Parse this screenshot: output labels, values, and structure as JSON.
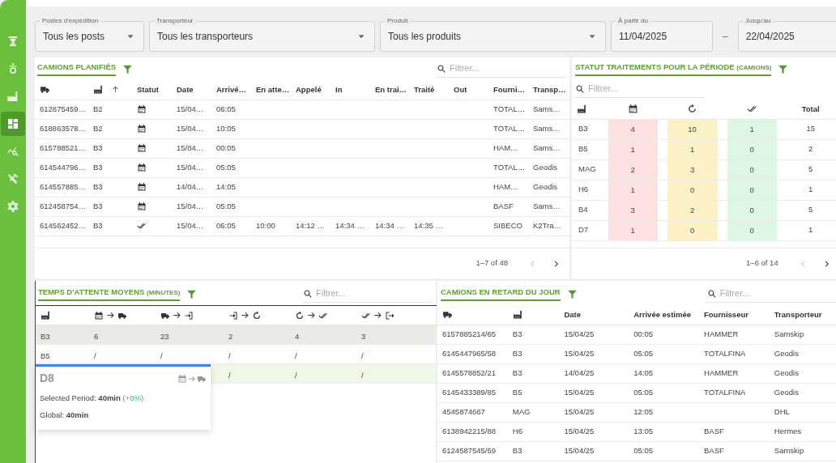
{
  "sidebar": {
    "items": [
      {
        "kind": "hopper",
        "selected": false
      },
      {
        "kind": "weight",
        "selected": false
      },
      {
        "kind": "factory",
        "selected": false
      },
      {
        "kind": "dashboard",
        "selected": true
      },
      {
        "kind": "analytics",
        "selected": false
      },
      {
        "kind": "tools",
        "selected": false
      },
      {
        "kind": "settings",
        "selected": false
      }
    ]
  },
  "filters": [
    {
      "kind": "select",
      "label": "Postes d'expédition",
      "value": "Tous les posts"
    },
    {
      "kind": "select",
      "label": "Transporteur",
      "value": "Tous les transporteurs"
    },
    {
      "kind": "select",
      "label": "Produit",
      "value": "Tous les produits"
    },
    {
      "kind": "date",
      "label": "À partir du",
      "value": "11/04/2025"
    },
    {
      "kind": "separator",
      "value": "–"
    },
    {
      "kind": "date",
      "label": "Jusqu'au",
      "value": "22/04/2025"
    }
  ],
  "planned_trucks": {
    "title": "CAMIONS PLANIFIÉS",
    "search": {
      "placeholder": "Filtrer..."
    },
    "columns": [
      {
        "kind": "truck"
      },
      {
        "kind": "site",
        "sorted": true
      },
      {
        "label": "Statut"
      },
      {
        "label": "Date"
      },
      {
        "label": "Arrivé…"
      },
      {
        "label": "En atte…"
      },
      {
        "label": "Appelé"
      },
      {
        "label": "In"
      },
      {
        "label": "En trai…"
      },
      {
        "label": "Traité"
      },
      {
        "label": "Out"
      },
      {
        "label": "Fourni…"
      },
      {
        "label": "Transp…"
      }
    ],
    "rows": [
      {
        "cells": [
          "612875459…",
          "B2",
          {
            "done": false
          },
          "15/04…",
          "06:05",
          "",
          "",
          "",
          "",
          "",
          "",
          "TOTAL…",
          "Sams…"
        ]
      },
      {
        "cells": [
          "618863578…",
          "B2",
          {
            "done": false
          },
          "15/04…",
          "10:05",
          "",
          "",
          "",
          "",
          "",
          "",
          "TOTAL…",
          "Sams…"
        ]
      },
      {
        "cells": [
          "615788521…",
          "B3",
          {
            "done": false
          },
          "15/04…",
          "00:05",
          "",
          "",
          "",
          "",
          "",
          "",
          "HAM…",
          "Sams…"
        ]
      },
      {
        "cells": [
          "614544796…",
          "B3",
          {
            "done": false
          },
          "15/04…",
          "05:05",
          "",
          "",
          "",
          "",
          "",
          "",
          "TOTAL…",
          "Geodis"
        ]
      },
      {
        "cells": [
          "614557885…",
          "B3",
          {
            "done": false
          },
          "14/04…",
          "14:05",
          "",
          "",
          "",
          "",
          "",
          "",
          "HAM…",
          "Geodis"
        ]
      },
      {
        "cells": [
          "612458754…",
          "B3",
          {
            "done": false
          },
          "15/04…",
          "05:05",
          "",
          "",
          "",
          "",
          "",
          "",
          "BASF",
          "Sams…"
        ]
      },
      {
        "cells": [
          "614562452…",
          "B3",
          {
            "done": true
          },
          "15/04…",
          "06:05",
          "10:00",
          "14:12 …",
          "14:34 …",
          "14:34 …",
          "14:35 …",
          "",
          "SIBECO",
          "K2Tra…"
        ]
      }
    ],
    "pagination": {
      "range": "1–7 of 48",
      "prev_disabled": true,
      "next_disabled": false
    }
  },
  "status_summary": {
    "title": "STATUT TRAITEMENTS POUR LA PÉRIODE",
    "subtitle": "(CAMIONS)",
    "search": {
      "placeholder": "Filtrer..."
    },
    "columns": [
      {
        "kind": "site"
      },
      {
        "kind": "planned",
        "color": "#fde1e1"
      },
      {
        "kind": "in_progress",
        "color": "#fdf1c6"
      },
      {
        "kind": "done",
        "color": "#ddf7e4"
      },
      {
        "kind": "total",
        "label": "Total"
      }
    ],
    "rows": [
      {
        "cells": [
          "B3",
          "4",
          "10",
          "1",
          "15"
        ]
      },
      {
        "cells": [
          "B5",
          "1",
          "1",
          "0",
          "2"
        ]
      },
      {
        "cells": [
          "MAG",
          "2",
          "3",
          "0",
          "5"
        ]
      },
      {
        "cells": [
          "H6",
          "1",
          "0",
          "0",
          "1"
        ]
      },
      {
        "cells": [
          "B4",
          "3",
          "2",
          "0",
          "5"
        ]
      },
      {
        "cells": [
          "D7",
          "1",
          "0",
          "0",
          "1"
        ]
      }
    ],
    "pagination": {
      "range": "1–6 of 14",
      "prev_disabled": true,
      "next_disabled": false
    }
  },
  "waiting_times": {
    "title": "TEMPS D'ATTENTE MOYENS",
    "subtitle": "(MINUTES)",
    "search": {
      "placeholder": "Filtrer..."
    },
    "columns": [
      {
        "kind": "site"
      },
      {
        "kind": "planned_to_arrived"
      },
      {
        "kind": "arrived_to_in"
      },
      {
        "kind": "in_to_processing"
      },
      {
        "kind": "processing_to_done"
      },
      {
        "kind": "done_to_out"
      }
    ],
    "rows": [
      {
        "selected": true,
        "hovered": false,
        "cells": [
          "B3",
          "6",
          "23",
          "2",
          "4",
          "3"
        ]
      },
      {
        "selected": false,
        "hovered": false,
        "cells": [
          "B5",
          "/",
          "/",
          "/",
          "/",
          "/"
        ]
      },
      {
        "selected": false,
        "hovered": true,
        "cells": [
          null,
          null,
          null,
          "/",
          "/",
          "/"
        ]
      }
    ],
    "tooltip": {
      "title": "D8",
      "lines": [
        {
          "label": "Selected Period:",
          "value": "40min",
          "change": "(+0%)"
        },
        {
          "label": "Global:",
          "value": "40min"
        }
      ]
    }
  },
  "late_trucks": {
    "title": "CAMIONS EN RETARD DU JOUR",
    "search": {
      "placeholder": "Filtrer..."
    },
    "columns": [
      {
        "kind": "truck"
      },
      {
        "kind": "site"
      },
      {
        "label": "Date"
      },
      {
        "label": "Arrivée estimée"
      },
      {
        "label": "Fournisseur"
      },
      {
        "label": "Transporteur"
      }
    ],
    "rows": [
      {
        "cells": [
          "6157885214/65",
          "B3",
          "15/04/25",
          "00:05",
          "HAMMER",
          "Samskip"
        ]
      },
      {
        "cells": [
          "6145447965/58",
          "B3",
          "15/04/25",
          "05:05",
          "TOTALFINA",
          "Geodis"
        ]
      },
      {
        "cells": [
          "6145578852/21",
          "B3",
          "14/04/25",
          "14:05",
          "HAMMER",
          "Geodis"
        ]
      },
      {
        "cells": [
          "6145433389/85",
          "B5",
          "15/04/25",
          "05:05",
          "TOTALFINA",
          "Geodis"
        ]
      },
      {
        "cells": [
          "4545874667",
          "MAG",
          "15/04/25",
          "12:05",
          "",
          "DHL"
        ]
      },
      {
        "cells": [
          "6138942215/88",
          "H6",
          "15/04/25",
          "13:05",
          "BASF",
          "Hermes"
        ]
      },
      {
        "cells": [
          "6124587545/59",
          "B3",
          "15/04/25",
          "05:05",
          "BASF",
          "Samskip"
        ]
      }
    ]
  }
}
